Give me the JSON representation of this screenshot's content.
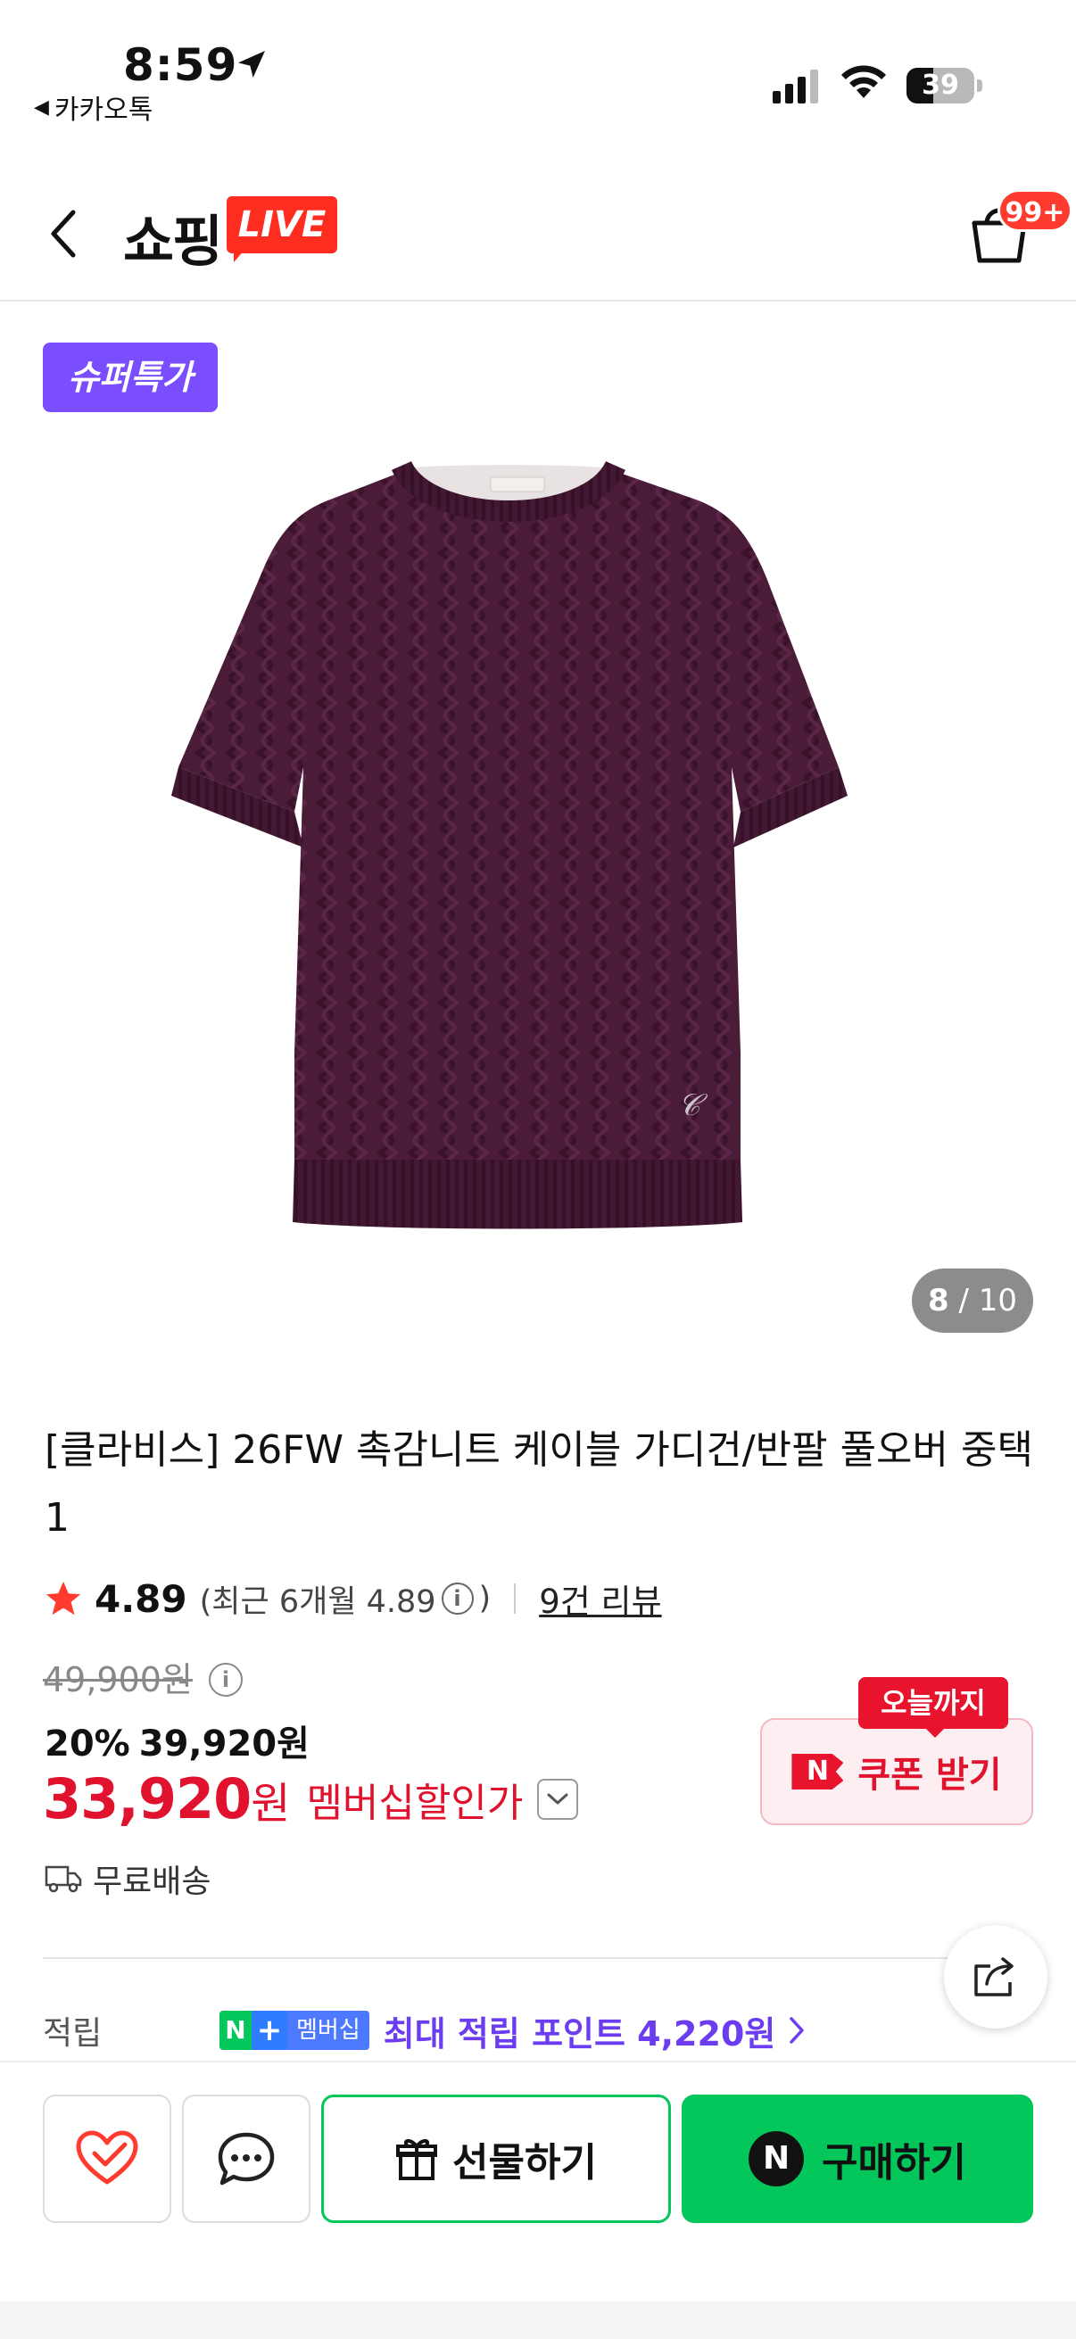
{
  "status_bar": {
    "time": "8:59",
    "back_app": "카카오톡",
    "battery": "39",
    "battery_level": 0.39
  },
  "header": {
    "logo_text": "쇼핑",
    "logo_badge": "LIVE",
    "cart_count": "99+"
  },
  "product": {
    "super_badge": "슈퍼특가",
    "image_current": "8",
    "image_total": "10",
    "image_sep": "/",
    "title": "[클라비스] 26FW 촉감니트 케이블 가디건/반팔 풀오버 중택1",
    "rating": "4.89",
    "rating_recent": "(최근 6개월 4.89",
    "rating_recent_close": ")",
    "review_link": "9건 리뷰",
    "original_price": "49,900원",
    "discount_rate": "20%",
    "discount_price": "39,920원",
    "member_price": "33,920",
    "member_price_unit": "원",
    "member_price_label": "멤버십할인가",
    "shipping": "무료배송"
  },
  "coupon": {
    "tag": "오늘까지",
    "n_logo": "N",
    "label": "쿠폰 받기"
  },
  "points": {
    "label": "적립",
    "badge_n": "N",
    "badge_plus": "+",
    "badge_text": "멤버십",
    "text": "최대 적립 포인트 4,220원"
  },
  "bottom_bar": {
    "gift_label": "선물하기",
    "buy_n": "N",
    "buy_label": "구매하기"
  },
  "colors": {
    "accent_green": "#03c75a",
    "member_red": "#e0122d",
    "super_purple": "#7a4dff",
    "live_red": "#ff2d1f",
    "sweater": "#4a1c38"
  }
}
